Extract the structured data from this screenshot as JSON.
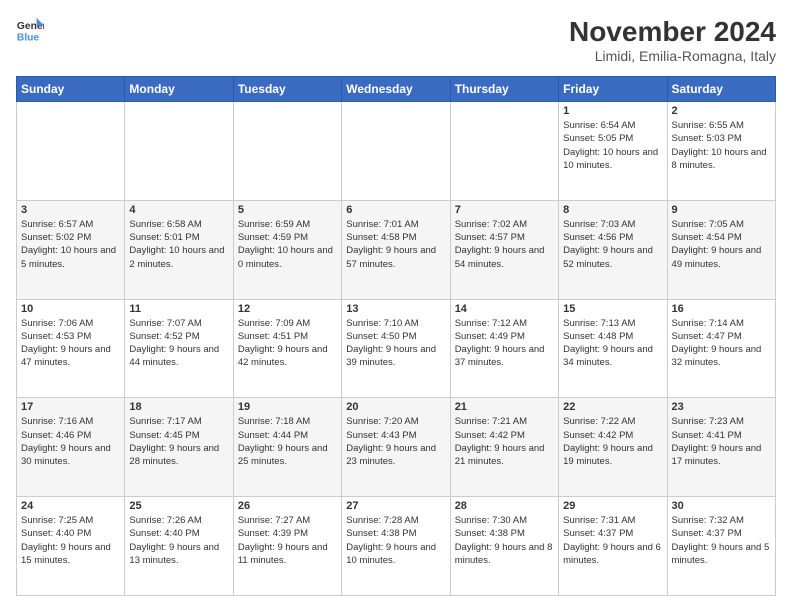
{
  "logo": {
    "line1": "General",
    "line2": "Blue"
  },
  "title": "November 2024",
  "location": "Limidi, Emilia-Romagna, Italy",
  "days_header": [
    "Sunday",
    "Monday",
    "Tuesday",
    "Wednesday",
    "Thursday",
    "Friday",
    "Saturday"
  ],
  "weeks": [
    [
      {
        "day": "",
        "info": ""
      },
      {
        "day": "",
        "info": ""
      },
      {
        "day": "",
        "info": ""
      },
      {
        "day": "",
        "info": ""
      },
      {
        "day": "",
        "info": ""
      },
      {
        "day": "1",
        "info": "Sunrise: 6:54 AM\nSunset: 5:05 PM\nDaylight: 10 hours and 10 minutes."
      },
      {
        "day": "2",
        "info": "Sunrise: 6:55 AM\nSunset: 5:03 PM\nDaylight: 10 hours and 8 minutes."
      }
    ],
    [
      {
        "day": "3",
        "info": "Sunrise: 6:57 AM\nSunset: 5:02 PM\nDaylight: 10 hours and 5 minutes."
      },
      {
        "day": "4",
        "info": "Sunrise: 6:58 AM\nSunset: 5:01 PM\nDaylight: 10 hours and 2 minutes."
      },
      {
        "day": "5",
        "info": "Sunrise: 6:59 AM\nSunset: 4:59 PM\nDaylight: 10 hours and 0 minutes."
      },
      {
        "day": "6",
        "info": "Sunrise: 7:01 AM\nSunset: 4:58 PM\nDaylight: 9 hours and 57 minutes."
      },
      {
        "day": "7",
        "info": "Sunrise: 7:02 AM\nSunset: 4:57 PM\nDaylight: 9 hours and 54 minutes."
      },
      {
        "day": "8",
        "info": "Sunrise: 7:03 AM\nSunset: 4:56 PM\nDaylight: 9 hours and 52 minutes."
      },
      {
        "day": "9",
        "info": "Sunrise: 7:05 AM\nSunset: 4:54 PM\nDaylight: 9 hours and 49 minutes."
      }
    ],
    [
      {
        "day": "10",
        "info": "Sunrise: 7:06 AM\nSunset: 4:53 PM\nDaylight: 9 hours and 47 minutes."
      },
      {
        "day": "11",
        "info": "Sunrise: 7:07 AM\nSunset: 4:52 PM\nDaylight: 9 hours and 44 minutes."
      },
      {
        "day": "12",
        "info": "Sunrise: 7:09 AM\nSunset: 4:51 PM\nDaylight: 9 hours and 42 minutes."
      },
      {
        "day": "13",
        "info": "Sunrise: 7:10 AM\nSunset: 4:50 PM\nDaylight: 9 hours and 39 minutes."
      },
      {
        "day": "14",
        "info": "Sunrise: 7:12 AM\nSunset: 4:49 PM\nDaylight: 9 hours and 37 minutes."
      },
      {
        "day": "15",
        "info": "Sunrise: 7:13 AM\nSunset: 4:48 PM\nDaylight: 9 hours and 34 minutes."
      },
      {
        "day": "16",
        "info": "Sunrise: 7:14 AM\nSunset: 4:47 PM\nDaylight: 9 hours and 32 minutes."
      }
    ],
    [
      {
        "day": "17",
        "info": "Sunrise: 7:16 AM\nSunset: 4:46 PM\nDaylight: 9 hours and 30 minutes."
      },
      {
        "day": "18",
        "info": "Sunrise: 7:17 AM\nSunset: 4:45 PM\nDaylight: 9 hours and 28 minutes."
      },
      {
        "day": "19",
        "info": "Sunrise: 7:18 AM\nSunset: 4:44 PM\nDaylight: 9 hours and 25 minutes."
      },
      {
        "day": "20",
        "info": "Sunrise: 7:20 AM\nSunset: 4:43 PM\nDaylight: 9 hours and 23 minutes."
      },
      {
        "day": "21",
        "info": "Sunrise: 7:21 AM\nSunset: 4:42 PM\nDaylight: 9 hours and 21 minutes."
      },
      {
        "day": "22",
        "info": "Sunrise: 7:22 AM\nSunset: 4:42 PM\nDaylight: 9 hours and 19 minutes."
      },
      {
        "day": "23",
        "info": "Sunrise: 7:23 AM\nSunset: 4:41 PM\nDaylight: 9 hours and 17 minutes."
      }
    ],
    [
      {
        "day": "24",
        "info": "Sunrise: 7:25 AM\nSunset: 4:40 PM\nDaylight: 9 hours and 15 minutes."
      },
      {
        "day": "25",
        "info": "Sunrise: 7:26 AM\nSunset: 4:40 PM\nDaylight: 9 hours and 13 minutes."
      },
      {
        "day": "26",
        "info": "Sunrise: 7:27 AM\nSunset: 4:39 PM\nDaylight: 9 hours and 11 minutes."
      },
      {
        "day": "27",
        "info": "Sunrise: 7:28 AM\nSunset: 4:38 PM\nDaylight: 9 hours and 10 minutes."
      },
      {
        "day": "28",
        "info": "Sunrise: 7:30 AM\nSunset: 4:38 PM\nDaylight: 9 hours and 8 minutes."
      },
      {
        "day": "29",
        "info": "Sunrise: 7:31 AM\nSunset: 4:37 PM\nDaylight: 9 hours and 6 minutes."
      },
      {
        "day": "30",
        "info": "Sunrise: 7:32 AM\nSunset: 4:37 PM\nDaylight: 9 hours and 5 minutes."
      }
    ]
  ]
}
